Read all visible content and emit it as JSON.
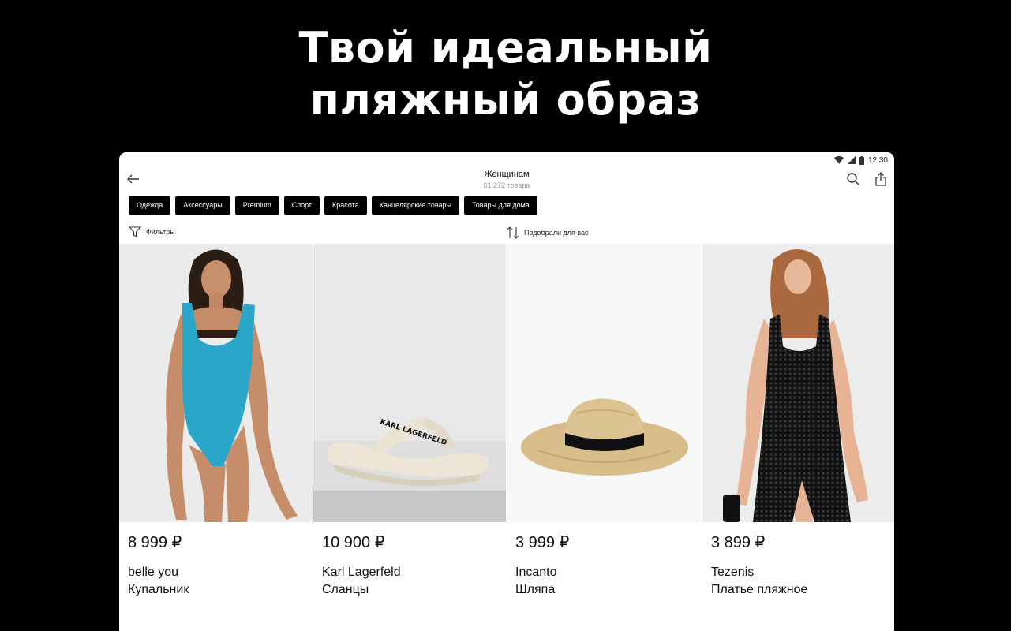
{
  "hero": {
    "line1": "Твой идеальный",
    "line2": "пляжный образ"
  },
  "status": {
    "time": "12:30"
  },
  "header": {
    "title": "Женщинам",
    "count": "61 272 товара"
  },
  "chips": [
    "Одежда",
    "Аксессуары",
    "Premium",
    "Спорт",
    "Красота",
    "Канцелярские товары",
    "Товары для дома"
  ],
  "toolbar": {
    "filters_label": "Фильтры",
    "sort_label": "Подобрали для вас"
  },
  "products": [
    {
      "price": "8 999 ₽",
      "brand": "belle you",
      "name": "Купальник"
    },
    {
      "price": "10 900 ₽",
      "brand": "Karl Lagerfeld",
      "name": "Сланцы",
      "print": "KARL LAGERFELD"
    },
    {
      "price": "3 999 ₽",
      "brand": "Incanto",
      "name": "Шляпа"
    },
    {
      "price": "3 899 ₽",
      "brand": "Tezenis",
      "name": "Платье пляжное"
    }
  ],
  "colors": {
    "background": "#000000",
    "chip_bg": "#000000",
    "chip_text": "#ffffff",
    "swimsuit": "#2aa6c9",
    "hat": "#d9bf8c"
  },
  "icons": {
    "back": "arrow-left-icon",
    "search": "search-icon",
    "share": "share-icon",
    "filter": "funnel-icon",
    "sort": "sort-icon"
  }
}
